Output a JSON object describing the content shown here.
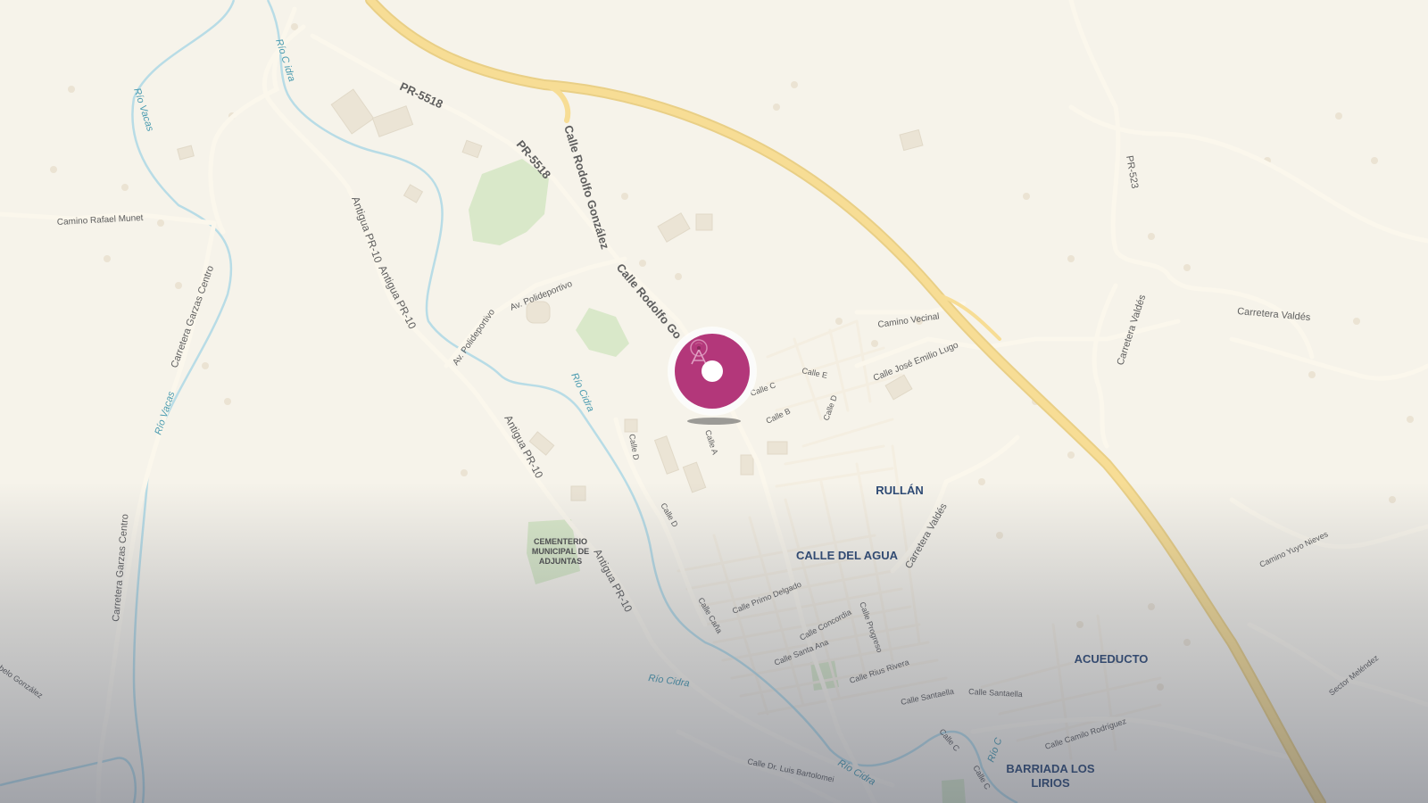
{
  "colors": {
    "land": "#f6f3ea",
    "road": "#fbf6ea",
    "road_edge": "#ece4d2",
    "highway": "#f5d98a",
    "water": "#aad3df",
    "water_label": "#4a9bb0",
    "park": "#d9e8c9",
    "building": "#ece6d8",
    "road_label": "#6b6b6b",
    "place_label": "#2e4a74",
    "marker": "#b3377a"
  },
  "labels": {
    "pr5518_a": "PR-5518",
    "pr5518_b": "PR-5518",
    "rodolfo_a": "Calle Rodolfo González",
    "rodolfo_b": "Calle Rodolfo Go",
    "polideportivo_a": "Av. Polideportivo",
    "polideportivo_b": "Av. Polideportivo",
    "antigua_a": "Antigua PR-10",
    "antigua_b": "Antigua PR-10",
    "antigua_c": "Antigua PR-10",
    "antigua_d": "Antigua PR-10",
    "rafael_munet": "Camino Rafael Munet",
    "garzas_a": "Carretera Garzas Centro",
    "garzas_b": "Carretera Garzas Centro",
    "pr523": "PR-523",
    "valdes_a": "Carretera Valdés",
    "valdes_b": "Carretera Valdés",
    "valdes_c": "Carretera Valdés",
    "vecinal": "Camino Vecinal",
    "emilio_lugo": "Calle José Emilio Lugo",
    "calle_e": "Calle E",
    "calle_c": "Calle C",
    "calle_d1": "Calle D",
    "calle_b": "Calle B",
    "calle_a": "Calle A",
    "calle_d2": "Calle D",
    "calle_d3": "Calle D",
    "primo_delgado": "Calle Primo Delgado",
    "cana": "Calle Caña",
    "concordia": "Calle Concordia",
    "progreso": "Calle Progreso",
    "santa_ana": "Calle Santa Ana",
    "rius_rivera": "Calle Rius Rivera",
    "santaella_a": "Calle Santaella",
    "santaella_b": "Calle Santaella",
    "camilo": "Calle Camilo Rodríguez",
    "calle_c2": "Calle C",
    "calle_c3": "Calle C",
    "bartolomei": "Calle Dr. Luis Bartolomei",
    "yuyo": "Camino Yuyo Nieves",
    "sector_melendez": "Sector Meléndez",
    "belo_gonzalez": "belo González"
  },
  "water_labels": {
    "rio_vacos_a": "Río Vacas",
    "rio_vacos_b": "Río Vacas",
    "rio_cidra_top": "Río C  idra",
    "rio_cidra_a": "Río Cidra",
    "rio_cidra_b": "Río Cidra",
    "rio_cidra_c": "Río Cidra",
    "rio_cidra_d": "Río C"
  },
  "places": {
    "rullan": "RULLÁN",
    "calle_del_agua": "CALLE DEL AGUA",
    "acueducto": "ACUEDUCTO",
    "barriada_1": "BARRIADA LOS",
    "barriada_2": "LIRIOS",
    "cementerio_1": "CEMENTERIO",
    "cementerio_2": "MUNICIPAL DE",
    "cementerio_3": "ADJUNTAS"
  },
  "marker": {
    "icon": "location-pin-icon"
  }
}
